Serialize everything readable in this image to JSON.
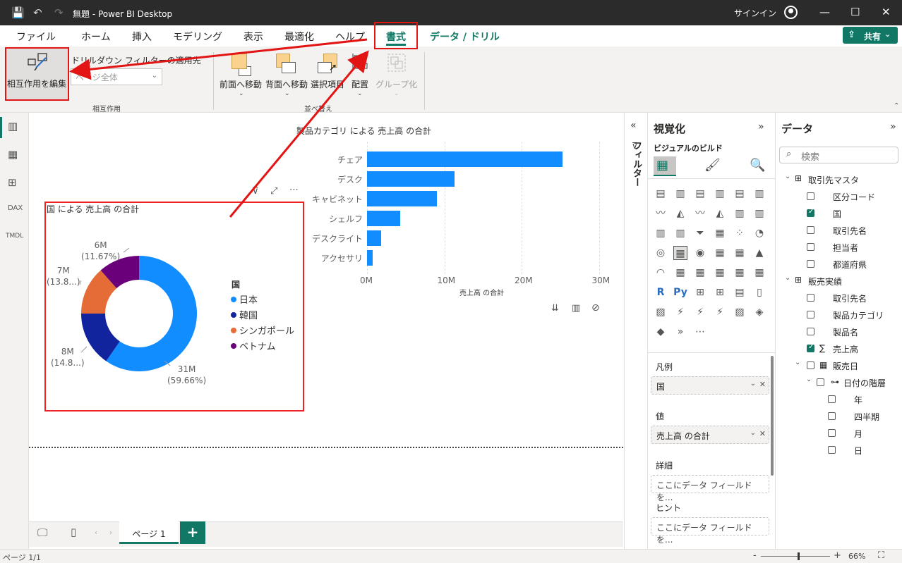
{
  "window": {
    "title": "無題 - Power BI Desktop",
    "signin": "サインイン"
  },
  "menu": {
    "tabs": [
      "ファイル",
      "ホーム",
      "挿入",
      "モデリング",
      "表示",
      "最適化",
      "ヘルプ",
      "書式",
      "データ / ドリル"
    ],
    "active": "書式",
    "share": "共有"
  },
  "ribbon": {
    "edit_interactions": "相互作用を編集",
    "drilldown_filter_label": "ドリルダウン フィルターの適用先",
    "drilldown_filter_value": "ページ全体",
    "group_interactions": "相互作用",
    "bring_forward": "前面へ移動",
    "send_backward": "背面へ移動",
    "selection": "選択項目",
    "align": "配置",
    "group": "グループ化",
    "group_arrange": "並べ替え"
  },
  "bar_chart": {
    "title": "製品カテゴリ による 売上高 の合計",
    "xlabel": "売上高 の合計",
    "ticks": [
      "0M",
      "10M",
      "20M",
      "30M"
    ]
  },
  "donut_chart": {
    "title": "国 による 売上高 の合計",
    "legend_title": "国",
    "labels": [
      {
        "value": "31M",
        "pct": "(59.66%)"
      },
      {
        "value": "8M",
        "pct": "(14.8...)"
      },
      {
        "value": "7M",
        "pct": "(13.8...)"
      },
      {
        "value": "6M",
        "pct": "(11.67%)"
      }
    ]
  },
  "chart_data": [
    {
      "type": "bar",
      "title": "製品カテゴリ による 売上高 の合計",
      "categories": [
        "チェア",
        "デスク",
        "キャビネット",
        "シェルフ",
        "デスクライト",
        "アクセサリ"
      ],
      "values": [
        25.3,
        11.3,
        9.0,
        4.3,
        1.8,
        0.7
      ],
      "xlabel": "売上高 の合計",
      "xlim": [
        0,
        31
      ],
      "units": "M",
      "color": "#118dff"
    },
    {
      "type": "pie",
      "title": "国 による 売上高 の合計",
      "categories": [
        "日本",
        "韓国",
        "シンガポール",
        "ベトナム"
      ],
      "values": [
        31,
        8,
        7,
        6
      ],
      "percent": [
        59.66,
        14.8,
        13.8,
        11.67
      ],
      "colors": [
        "#118dff",
        "#12239e",
        "#e66c37",
        "#6b007b"
      ]
    }
  ],
  "status": {
    "page": "ページ 1/1",
    "zoom": "66%"
  },
  "pages": {
    "tab": "ページ 1"
  },
  "filters": {
    "label": "フィルター"
  },
  "viz_pane": {
    "title": "視覚化",
    "build": "ビジュアルのビルド",
    "legend_label": "凡例",
    "legend_field": "国",
    "values_label": "値",
    "values_field": "売上高 の合計",
    "details_label": "詳細",
    "details_placeholder": "ここにデータ フィールドを...",
    "tooltip_label": "ヒント",
    "tooltip_placeholder": "ここにデータ フィールドを..."
  },
  "data_pane": {
    "title": "データ",
    "search_placeholder": "検索",
    "tables": [
      {
        "name": "取引先マスタ",
        "fields": [
          {
            "name": "区分コード",
            "checked": false
          },
          {
            "name": "国",
            "checked": true
          },
          {
            "name": "取引先名",
            "checked": false
          },
          {
            "name": "担当者",
            "checked": false
          },
          {
            "name": "都道府県",
            "checked": false
          }
        ]
      },
      {
        "name": "販売実績",
        "fields": [
          {
            "name": "取引先名",
            "checked": false
          },
          {
            "name": "製品カテゴリ",
            "checked": false
          },
          {
            "name": "製品名",
            "checked": false
          },
          {
            "name": "売上高",
            "checked": true
          },
          {
            "name": "販売日",
            "checked": false
          },
          {
            "name": "日付の階層",
            "checked": false
          },
          {
            "name": "年",
            "checked": false
          },
          {
            "name": "四半期",
            "checked": false
          },
          {
            "name": "月",
            "checked": false
          },
          {
            "name": "日",
            "checked": false
          }
        ]
      }
    ]
  }
}
